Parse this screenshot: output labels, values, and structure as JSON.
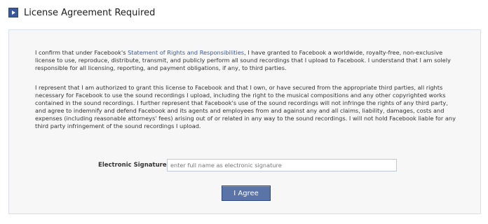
{
  "header": {
    "title": "License Agreement Required",
    "icon": "play-arrow-icon"
  },
  "agreement": {
    "p1_before_link": "I confirm that under Facebook's ",
    "p1_link": "Statement of Rights and Responsibilities",
    "p1_after_link": ", I have granted to Facebook a worldwide, royalty-free, non-exclusive license to use, reproduce, distribute, transmit, and publicly perform all sound recordings that I upload to Facebook. I understand that I am solely responsible for all licensing, reporting, and payment obligations, if any, to third parties.",
    "p2": "I represent that I am authorized to grant this license to Facebook and that I own, or have secured from the appropriate third parties, all rights necessary for Facebook to use the sound recordings I upload, including the right to the musical compositions and any other copyrighted works contained in the sound recordings. I further represent that Facebook's use of the sound recordings will not infringe the rights of any third party, and agree to indemnify and defend Facebook and its agents and employees from and against any and all claims, liability, damages, costs and expenses (including reasonable attorneys' fees) arising out of or related in any way to the sound recordings. I will not hold Facebook liable for any third party infringement of the sound recordings I upload."
  },
  "signature": {
    "label": "Electronic Signature:",
    "value": "",
    "placeholder": "enter full name as electronic signature"
  },
  "buttons": {
    "agree_label": "I Agree"
  },
  "colors": {
    "accent": "#3b5998",
    "button_bg": "#5b74a8",
    "panel_bg": "#f7f7f7",
    "panel_border": "#d8dfea"
  }
}
